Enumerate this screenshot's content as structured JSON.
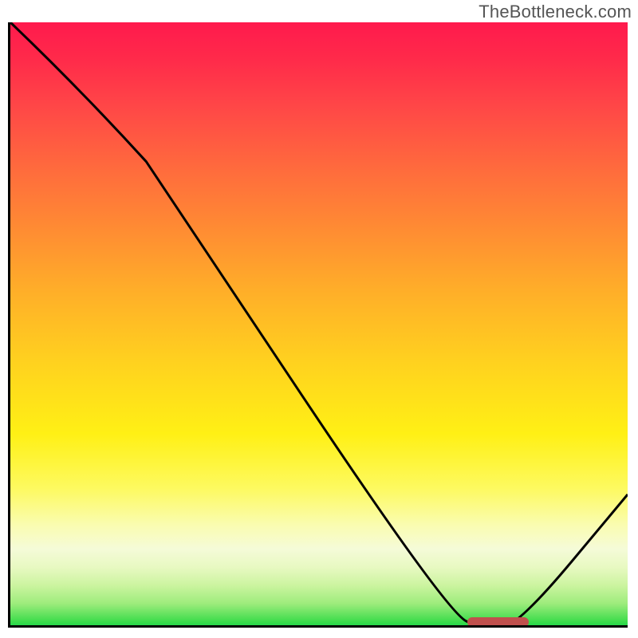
{
  "watermark": "TheBottleneck.com",
  "colors": {
    "axis": "#000000",
    "curve_stroke": "#000000",
    "marker_fill": "#c0504d",
    "gradient_top": "#ff1a4d",
    "gradient_bottom": "#18d64a"
  },
  "chart_data": {
    "type": "line",
    "title": "",
    "xlabel": "",
    "ylabel": "",
    "xlim": [
      0,
      100
    ],
    "ylim": [
      0,
      100
    ],
    "x": [
      0,
      22,
      71,
      77,
      82,
      100
    ],
    "y": [
      100,
      77,
      2,
      0,
      0,
      22
    ],
    "optimum_band": {
      "x_start": 74,
      "x_end": 84,
      "y": 0
    },
    "note": "x and y are in percent of the plot area; (0,0) is bottom-left. Curve shape is approximate (no axis ticks present)."
  }
}
